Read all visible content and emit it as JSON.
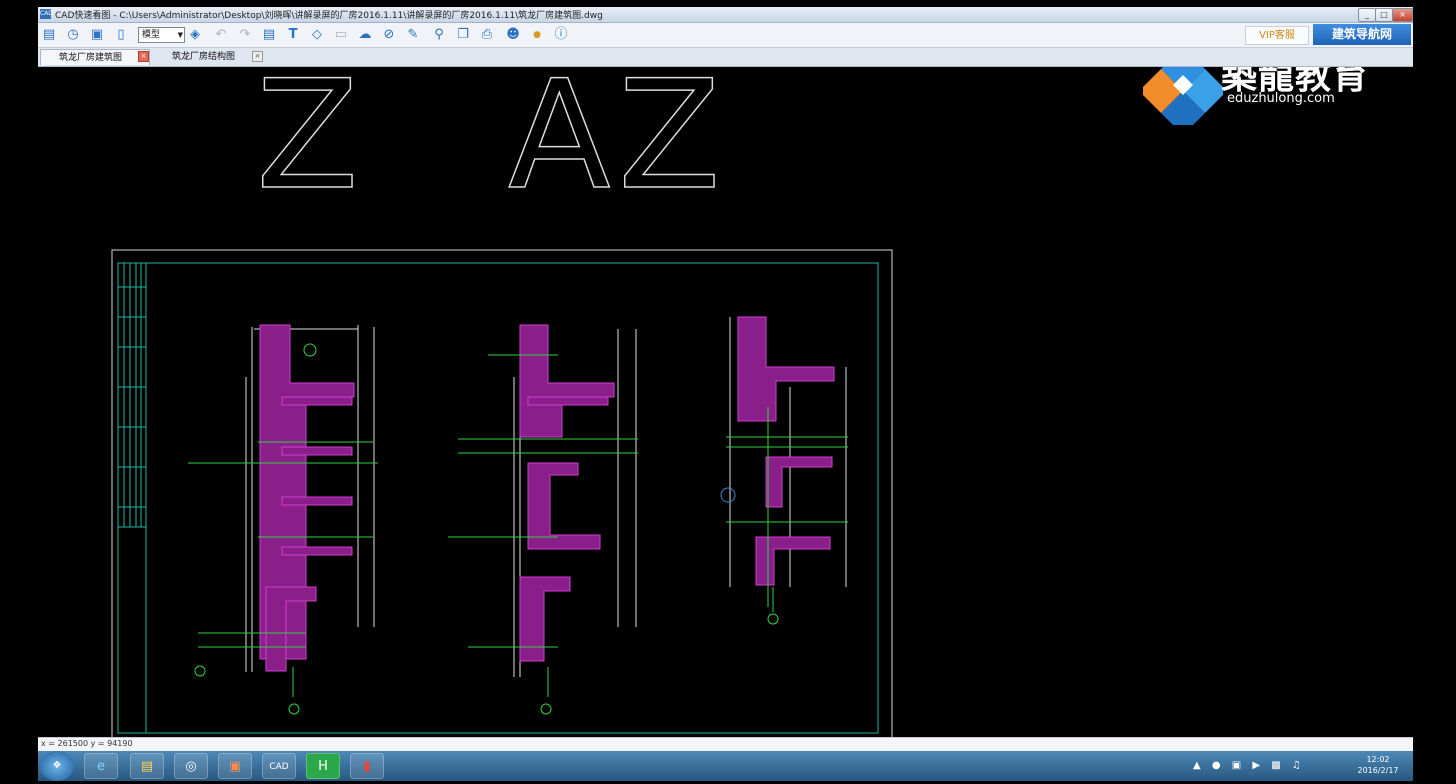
{
  "window": {
    "app_icon": "CAD",
    "title": "CAD快速看图 - C:\\Users\\Administrator\\Desktop\\刘晓晖\\讲解录屏的厂房2016.1.11\\讲解录屏的厂房2016.1.11\\筑龙厂房建筑图.dwg",
    "min": "_",
    "max": "□",
    "close": "×"
  },
  "toolbar": {
    "icons": [
      "open-folder-icon",
      "history-icon",
      "fit-extents-icon",
      "bookmark-icon",
      "layer-icon",
      "undo-icon",
      "redo-icon",
      "measure-icon",
      "text-icon",
      "eraser-icon",
      "delete-icon",
      "cloud-icon",
      "hide-icon",
      "pen-icon",
      "find-icon",
      "copy-icon",
      "print-icon",
      "user-icon",
      "vip-icon",
      "info-icon"
    ],
    "space_select": "模型",
    "vip_label": "VIP客服",
    "nav_label": "建筑导航网"
  },
  "tabs": [
    {
      "label": "筑龙厂房建筑图",
      "active": true
    },
    {
      "label": "筑龙厂房结构图",
      "active": false
    }
  ],
  "drawing": {
    "grid_labels": [
      "Z",
      "A",
      "Z"
    ]
  },
  "logo": {
    "brand": "築龍教育",
    "url": "eduzhulong.com"
  },
  "status": {
    "coords": "x = 261500  y = 94190"
  },
  "taskbar": {
    "start": "start-icon",
    "apps": [
      "ie-icon",
      "folder-icon",
      "media-icon",
      "office-icon",
      "cad-icon",
      "green-app-icon",
      "red-app-icon"
    ],
    "clock_time": "12:02",
    "clock_date": "2016/2/17"
  }
}
